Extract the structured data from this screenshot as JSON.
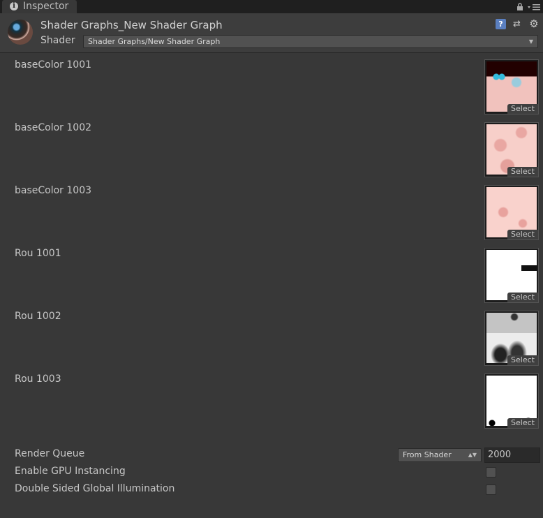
{
  "tab": {
    "label": "Inspector"
  },
  "header": {
    "title": "Shader Graphs_New Shader Graph",
    "shader_label": "Shader",
    "shader_value": "Shader Graphs/New Shader Graph"
  },
  "properties": [
    {
      "label": "baseColor 1001",
      "button": "Select"
    },
    {
      "label": "baseColor 1002",
      "button": "Select"
    },
    {
      "label": "baseColor 1003",
      "button": "Select"
    },
    {
      "label": "Rou 1001",
      "button": "Select"
    },
    {
      "label": "Rou 1002",
      "button": "Select"
    },
    {
      "label": "Rou 1003",
      "button": "Select"
    }
  ],
  "render_queue": {
    "label": "Render Queue",
    "mode": "From Shader",
    "value": "2000"
  },
  "gpu_instancing": {
    "label": "Enable GPU Instancing",
    "checked": false
  },
  "double_sided_gi": {
    "label": "Double Sided Global Illumination",
    "checked": false
  }
}
